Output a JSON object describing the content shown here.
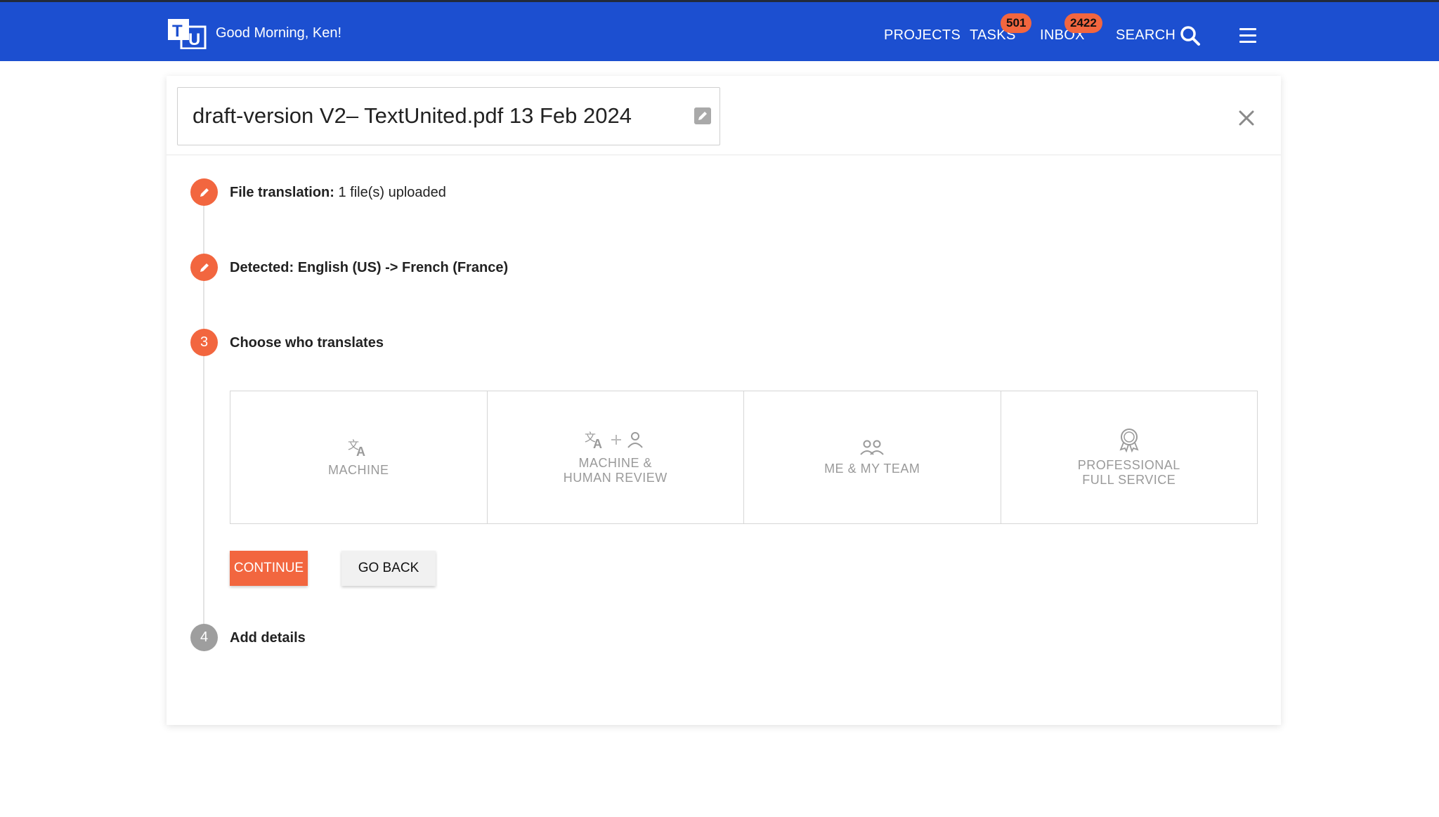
{
  "header": {
    "logo_text": "TU",
    "greeting": "Good Morning, Ken!",
    "nav": {
      "projects": "PROJECTS",
      "tasks": "TASKS",
      "tasks_badge": "501",
      "inbox": "INBOX",
      "inbox_badge": "2422",
      "search": "SEARCH"
    }
  },
  "project": {
    "title": "draft-version V2– TextUnited.pdf 13 Feb 2024"
  },
  "steps": [
    {
      "number": "",
      "label_bold": "File translation:",
      "label_rest": " 1 file(s) uploaded",
      "state": "done"
    },
    {
      "number": "",
      "label_bold": "Detected: English (US) -> French (France)",
      "label_rest": "",
      "state": "done"
    },
    {
      "number": "3",
      "label_bold": "Choose who translates",
      "label_rest": "",
      "state": "active"
    },
    {
      "number": "4",
      "label_bold": "Add details",
      "label_rest": "",
      "state": "pending"
    }
  ],
  "options": [
    {
      "lines": [
        "MACHINE"
      ],
      "icon": "translate-icon"
    },
    {
      "lines": [
        "MACHINE &",
        "HUMAN REVIEW"
      ],
      "icon": "translate-plus-person-icon"
    },
    {
      "lines": [
        "ME & MY TEAM"
      ],
      "icon": "team-icon"
    },
    {
      "lines": [
        "PROFESSIONAL",
        "FULL SERVICE"
      ],
      "icon": "certified-badge-icon"
    }
  ],
  "buttons": {
    "continue": "CONTINUE",
    "go_back": "GO BACK"
  },
  "colors": {
    "topbar": "#1c4fd0",
    "accent": "#f2663f",
    "pending_step": "#9e9e9e"
  }
}
